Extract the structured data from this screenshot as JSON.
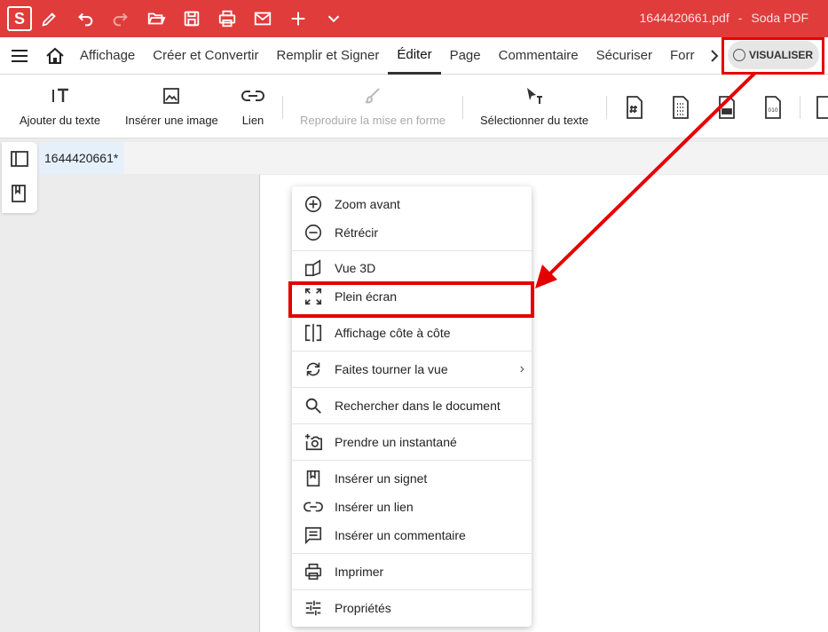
{
  "app": {
    "logo_letter": "S",
    "file_name": "1644420661.pdf",
    "separator": "-",
    "app_name": "Soda PDF",
    "accent": "#e03c3c"
  },
  "quick_access": [
    {
      "name": "pen-icon"
    },
    {
      "name": "undo-icon"
    },
    {
      "name": "redo-icon"
    },
    {
      "name": "open-folder-icon"
    },
    {
      "name": "save-icon"
    },
    {
      "name": "print-icon"
    },
    {
      "name": "mail-icon"
    },
    {
      "name": "plus-icon"
    },
    {
      "name": "chevron-down-icon"
    }
  ],
  "menu_tabs": [
    "Affichage",
    "Créer et Convertir",
    "Remplir et Signer",
    "Éditer",
    "Page",
    "Commentaire",
    "Sécuriser",
    "Forr"
  ],
  "active_tab": "Éditer",
  "visualiser_label": "VISUALISER",
  "toolbar": {
    "add_text": "Ajouter du texte",
    "insert_image": "Insérer une image",
    "link": "Lien",
    "format_painter": "Reproduire la mise en forme",
    "select_text": "Sélectionner du texte"
  },
  "document_tab": "1644420661*",
  "context_menu": {
    "zoom_in": "Zoom avant",
    "zoom_out": "Rétrécir",
    "view_3d": "Vue 3D",
    "fullscreen": "Plein écran",
    "side_by_side": "Affichage côte à côte",
    "rotate_view": "Faites tourner la vue",
    "search_doc": "Rechercher dans le document",
    "snapshot": "Prendre un instantané",
    "insert_bookmark": "Insérer un signet",
    "insert_link": "Insérer un lien",
    "insert_comment": "Insérer un commentaire",
    "print": "Imprimer",
    "properties": "Propriétés",
    "submenu_indicator": "›"
  },
  "annotation_color": "#e50000"
}
